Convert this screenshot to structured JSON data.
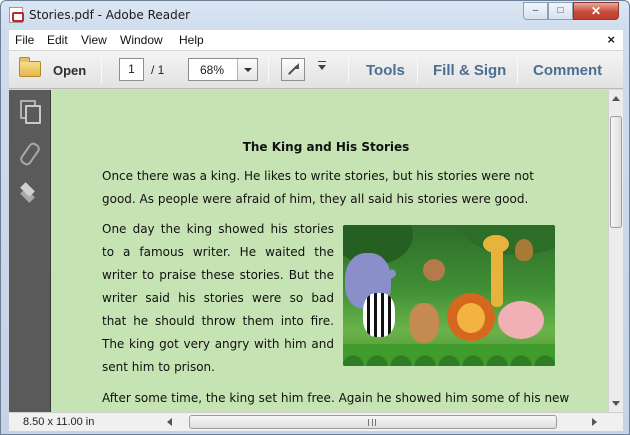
{
  "window": {
    "title": "Stories.pdf - Adobe Reader",
    "controls": {
      "minimize": "–",
      "maximize": "□",
      "close": "✕"
    }
  },
  "menubar": {
    "items": [
      "File",
      "Edit",
      "View",
      "Window",
      "Help"
    ],
    "close_doc": "×"
  },
  "toolbar": {
    "open_label": "Open",
    "page_current": "1",
    "page_total": "/ 1",
    "zoom": "68%",
    "tools_label": "Tools",
    "fill_sign_label": "Fill & Sign",
    "comment_label": "Comment",
    "icons": [
      "folder-open-icon",
      "fullscreen-icon",
      "more-tools-arrow-icon"
    ]
  },
  "navpane": {
    "icons": [
      "pages-icon",
      "attachments-icon",
      "layers-icon"
    ]
  },
  "document": {
    "title": "The King and His Stories",
    "paragraph1": "Once there was a king. He likes to write stories, but his stories were not good. As people were afraid of him, they all said his stories were good.",
    "paragraph2": "One day the king showed his stories to a famous writer. He waited the writer to praise these stories. But the writer said his stories were so bad that he should throw them into fire. The king got very angry with him and sent him to prison.",
    "paragraph3": "After some time, the king set him free. Again he showed him some of his new",
    "background": "#c6e3b3"
  },
  "statusbar": {
    "page_size": "8.50 x 11.00 in"
  }
}
